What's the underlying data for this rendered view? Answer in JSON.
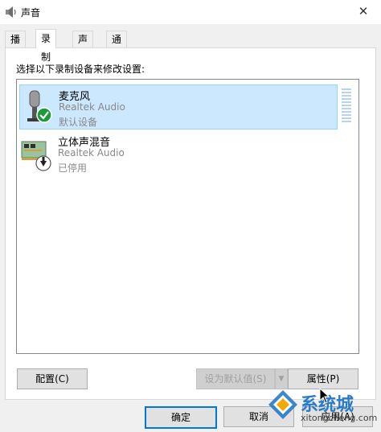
{
  "window": {
    "title": "声音"
  },
  "tabs": [
    {
      "label": "播放",
      "active": false
    },
    {
      "label": "录制",
      "active": true
    },
    {
      "label": "声音",
      "active": false
    },
    {
      "label": "通信",
      "active": false
    }
  ],
  "panel": {
    "instruction": "选择以下录制设备来修改设置:",
    "devices": [
      {
        "name": "麦克风",
        "driver": "Realtek Audio",
        "status": "默认设备",
        "icon": "microphone-icon",
        "badge": "check-badge-icon",
        "selected": true
      },
      {
        "name": "立体声混音",
        "driver": "Realtek Audio",
        "status": "已停用",
        "icon": "sound-card-icon",
        "badge": "disabled-arrow-badge-icon",
        "selected": false
      }
    ],
    "buttons": {
      "configure": "配置(C)",
      "set_default": "设为默认值(S)",
      "properties": "属性(P)"
    }
  },
  "footer": {
    "ok": "确定",
    "cancel": "取消",
    "apply": "应用(A)"
  },
  "watermark": {
    "text": "系统城",
    "sub": "xitongcheng.com"
  },
  "colors": {
    "selection": "#cce8ff",
    "accent": "#0078d7",
    "check_green": "#1a9b3a"
  }
}
